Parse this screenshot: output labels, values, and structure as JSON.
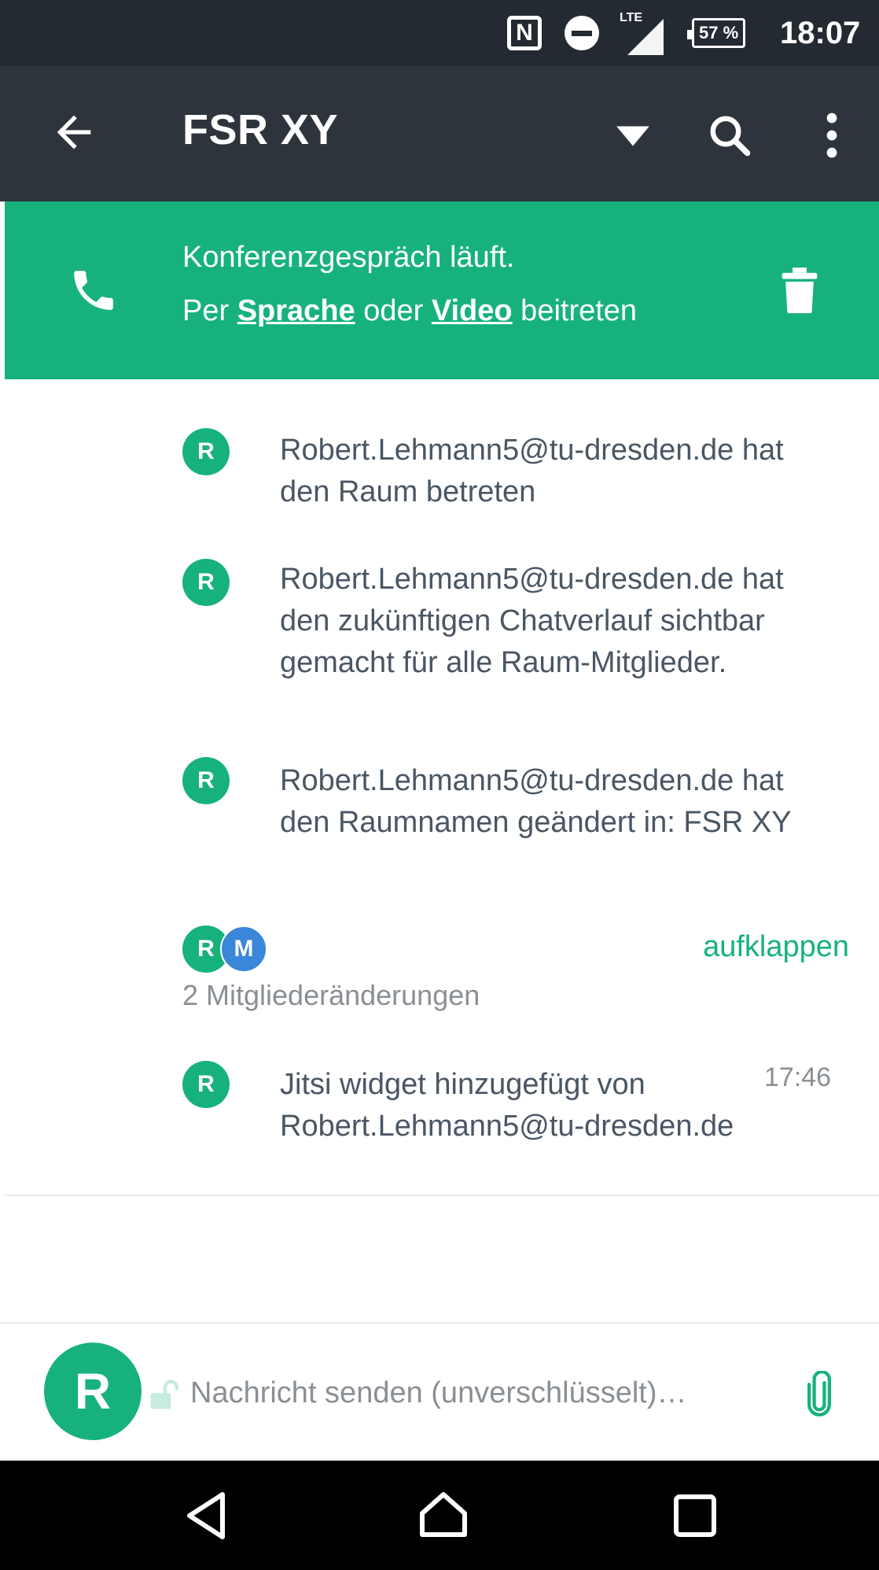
{
  "status_bar": {
    "nfc_label": "N",
    "network_label": "LTE",
    "battery": "57 %",
    "time": "18:07"
  },
  "app_bar": {
    "title": "FSR XY"
  },
  "conference_banner": {
    "line1": "Konferenzgespräch läuft.",
    "line2_prefix": "Per ",
    "voice_link": "Sprache",
    "line2_middle": " oder ",
    "video_link": "Video",
    "line2_suffix": " beitreten"
  },
  "timeline": {
    "events": [
      {
        "avatar": "R",
        "text": "Robert.Lehmann5@tu-dresden.de hat den Raum betreten"
      },
      {
        "avatar": "R",
        "text": "Robert.Lehmann5@tu-dresden.de hat den zukünftigen Chatverlauf sichtbar gemacht für alle Raum-Mitglieder."
      },
      {
        "avatar": "R",
        "text": "Robert.Lehmann5@tu-dresden.de hat den Raumnamen geändert in: FSR XY"
      }
    ],
    "member_changes": {
      "avatars": [
        "R",
        "M"
      ],
      "expand_label": "aufklappen",
      "summary": "2 Mitgliederänderungen"
    },
    "widget_event": {
      "avatar": "R",
      "text": "Jitsi widget hinzugefügt von Robert.Lehmann5@tu-dresden.de",
      "time": "17:46"
    }
  },
  "composer": {
    "avatar": "R",
    "placeholder": "Nachricht senden (unverschlüsselt)…"
  },
  "colors": {
    "accent": "#17b27c",
    "app_bar": "#2e343c",
    "status_bar": "#232a31",
    "text": "#4a5664",
    "secondary_text": "#8a8f95",
    "avatar_blue": "#3a86d9"
  }
}
